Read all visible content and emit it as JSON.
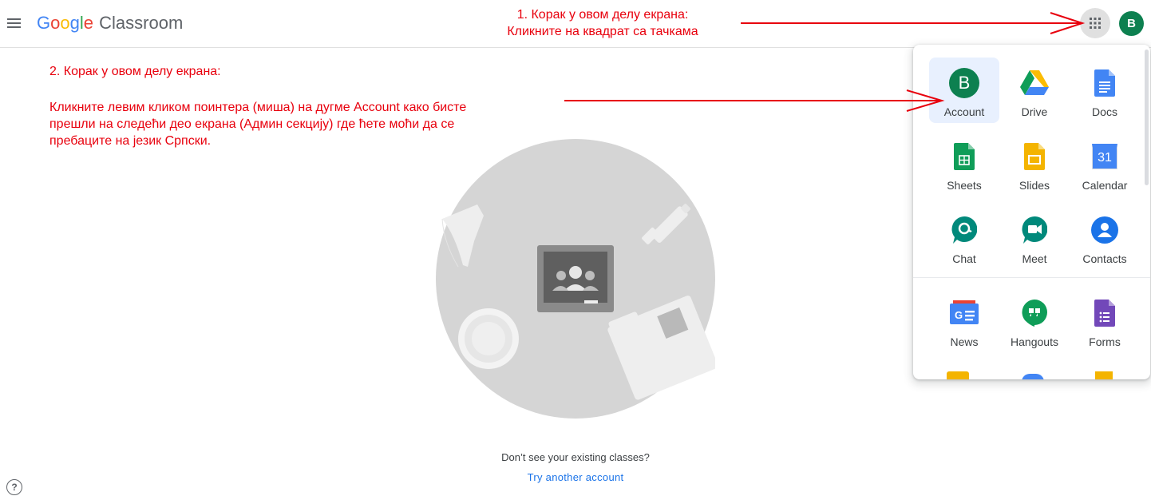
{
  "header": {
    "logo_google": [
      "G",
      "o",
      "o",
      "g",
      "l",
      "e"
    ],
    "logo_product": "Classroom",
    "avatar_letter": "B"
  },
  "annotations": {
    "step1_line1": "1. Корак у овом делу екрана:",
    "step1_line2": "Кликните на квадрат са тачкама",
    "step2_heading": "2. Корак у овом делу екрана:",
    "step2_line1": "Кликните левим кликом поинтера (миша) на дугме Account како бисте",
    "step2_line2": "прешли на следећи део екрана (Админ секцију) где ћете моћи да се",
    "step2_line3": "пребаците на језик Српски."
  },
  "main": {
    "empty_message": "Don’t see your existing classes?",
    "try_link": "Try another account"
  },
  "apps_panel": {
    "account_letter": "B",
    "calendar_day": "31",
    "apps": [
      {
        "label": "Account",
        "icon": "account-icon",
        "color": "#0d8050"
      },
      {
        "label": "Drive",
        "icon": "drive-icon",
        "color": "#1fa463"
      },
      {
        "label": "Docs",
        "icon": "docs-icon",
        "color": "#4285f4"
      },
      {
        "label": "Sheets",
        "icon": "sheets-icon",
        "color": "#0f9d58"
      },
      {
        "label": "Slides",
        "icon": "slides-icon",
        "color": "#f4b400"
      },
      {
        "label": "Calendar",
        "icon": "calendar-icon",
        "color": "#4285f4"
      },
      {
        "label": "Chat",
        "icon": "chat-icon",
        "color": "#00897b"
      },
      {
        "label": "Meet",
        "icon": "meet-icon",
        "color": "#00897b"
      },
      {
        "label": "Contacts",
        "icon": "contacts-icon",
        "color": "#1a73e8"
      },
      {
        "label": "News",
        "icon": "news-icon",
        "color": "#4285f4"
      },
      {
        "label": "Hangouts",
        "icon": "hangouts-icon",
        "color": "#0f9d58"
      },
      {
        "label": "Forms",
        "icon": "forms-icon",
        "color": "#7248b9"
      }
    ]
  },
  "colors": {
    "annotation_red": "#e8000d",
    "link_blue": "#1a73e8",
    "illustration_gray": "#d5d5d5"
  }
}
